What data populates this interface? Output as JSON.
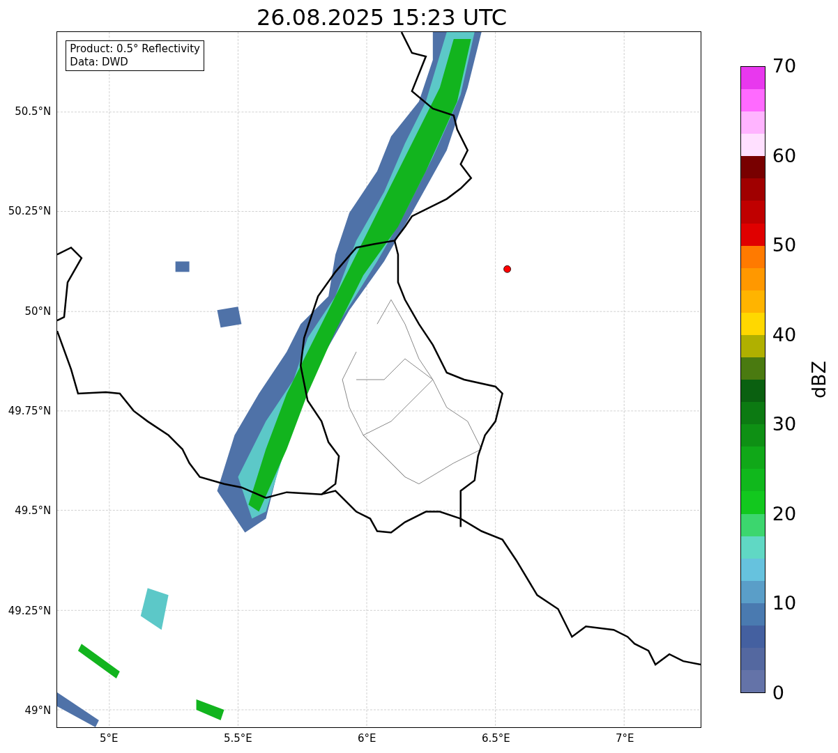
{
  "title": "26.08.2025 15:23 UTC",
  "legend": [
    "Product: 0.5° Reflectivity",
    "Data: DWD"
  ],
  "map": {
    "y_ticks": [
      "50.5°N",
      "50.25°N",
      "50°N",
      "49.75°N",
      "49.5°N",
      "49.25°N",
      "49°N"
    ],
    "x_ticks": [
      "5°E",
      "5.5°E",
      "6°E",
      "6.5°E",
      "7°E"
    ]
  },
  "colorbar": {
    "label": "dBZ",
    "ticks": [
      "70",
      "60",
      "50",
      "40",
      "30",
      "20",
      "10",
      "0"
    ],
    "segments": [
      {
        "color": "#e838ee"
      },
      {
        "color": "#ff6aff"
      },
      {
        "color": "#ffb4ff"
      },
      {
        "color": "#ffe0ff"
      },
      {
        "color": "#780000"
      },
      {
        "color": "#a00000"
      },
      {
        "color": "#c00000"
      },
      {
        "color": "#e00000"
      },
      {
        "color": "#ff7a00"
      },
      {
        "color": "#ff9800"
      },
      {
        "color": "#ffb400"
      },
      {
        "color": "#ffd800"
      },
      {
        "color": "#b0b000"
      },
      {
        "color": "#4a7a10"
      },
      {
        "color": "#0a6010"
      },
      {
        "color": "#0c7a12"
      },
      {
        "color": "#0e9014"
      },
      {
        "color": "#10a818"
      },
      {
        "color": "#10b81c"
      },
      {
        "color": "#12c81e"
      },
      {
        "color": "#3cd66e"
      },
      {
        "color": "#60d8c4"
      },
      {
        "color": "#66c2de"
      },
      {
        "color": "#5a9ec8"
      },
      {
        "color": "#4a7ab0"
      },
      {
        "color": "#4460a0"
      },
      {
        "color": "#5468a0"
      },
      {
        "color": "#6473a8"
      }
    ]
  }
}
